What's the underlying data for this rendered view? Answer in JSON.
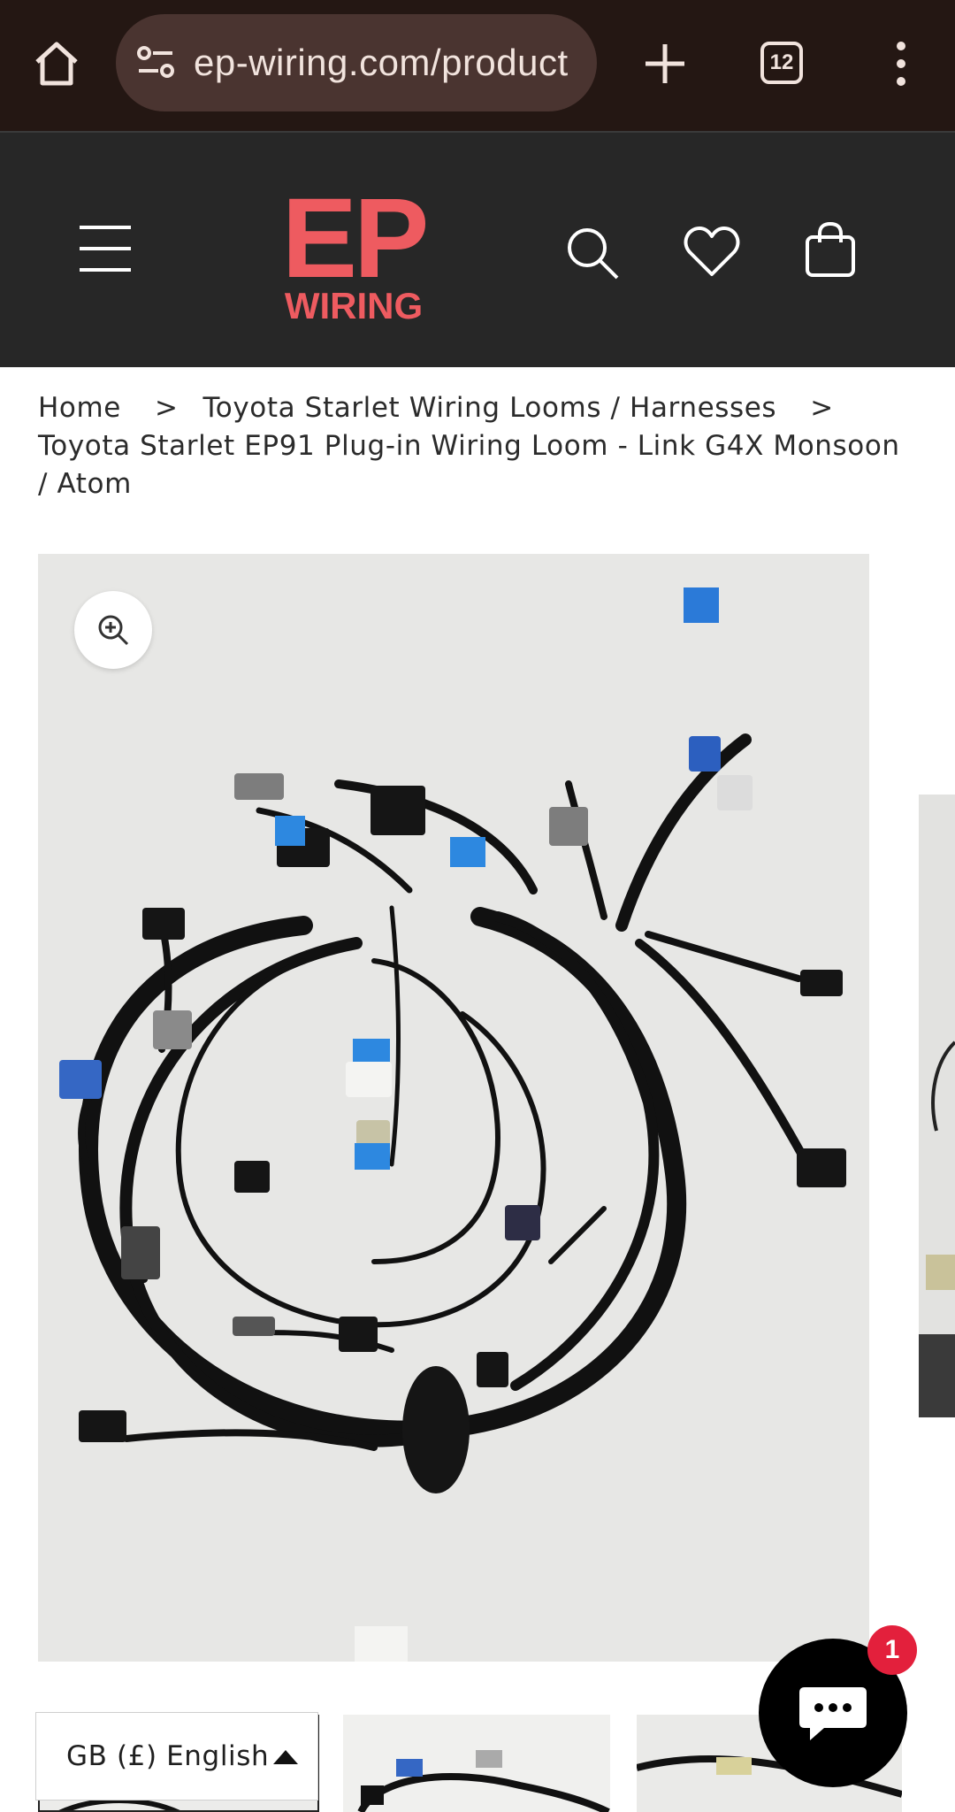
{
  "browser": {
    "url": "ep-wiring.com/product",
    "tab_count": "12"
  },
  "header": {
    "logo_top": "EP",
    "logo_bottom": "WIRING",
    "brand_color": "#ee5b60"
  },
  "breadcrumb": {
    "home": "Home",
    "category": "Toyota Starlet Wiring Looms / Harnesses",
    "current": "Toyota Starlet EP91 Plug-in Wiring Loom - Link G4X Monsoon / Atom",
    "separator": ">"
  },
  "locale": {
    "label": "GB (£) English"
  },
  "chat": {
    "badge_count": "1"
  }
}
